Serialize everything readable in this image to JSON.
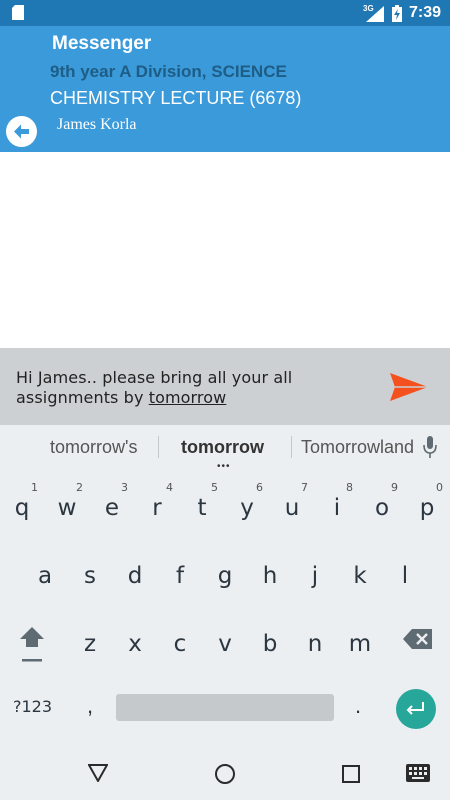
{
  "status_bar": {
    "network_type": "3G",
    "time": "7:39",
    "icons": [
      "sd-card-icon",
      "signal-icon",
      "battery-charging-icon"
    ]
  },
  "header": {
    "app_title": "Messenger",
    "class_name": "9th year A Division, SCIENCE",
    "lecture": "CHEMISTRY LECTURE  (6678)",
    "recipient": "James Korla",
    "back_icon": "back-arrow-icon"
  },
  "composer": {
    "message_prefix": "Hi James.. please bring all your all assignments by ",
    "message_underlined": "tomorrow",
    "send_icon": "send-icon",
    "send_color": "#f4511e"
  },
  "keyboard": {
    "suggestions": [
      "tomorrow's",
      "tomorrow",
      "Tomorrowland"
    ],
    "row1": [
      "q",
      "w",
      "e",
      "r",
      "t",
      "y",
      "u",
      "i",
      "o",
      "p"
    ],
    "row1_numbers": [
      "1",
      "2",
      "3",
      "4",
      "5",
      "6",
      "7",
      "8",
      "9",
      "0"
    ],
    "row2": [
      "a",
      "s",
      "d",
      "f",
      "g",
      "h",
      "j",
      "k",
      "l"
    ],
    "row3": [
      "z",
      "x",
      "c",
      "v",
      "b",
      "n",
      "m"
    ],
    "symbols_label": "?123",
    "comma": ",",
    "period": ".",
    "enter_color": "#27a69a"
  },
  "colors": {
    "status_bar": "#1f77b4",
    "header": "#3b9ad9",
    "subtitle": "#1e5d86",
    "composer_bg": "#cdd0d2",
    "keyboard_bg": "#eceff1"
  }
}
